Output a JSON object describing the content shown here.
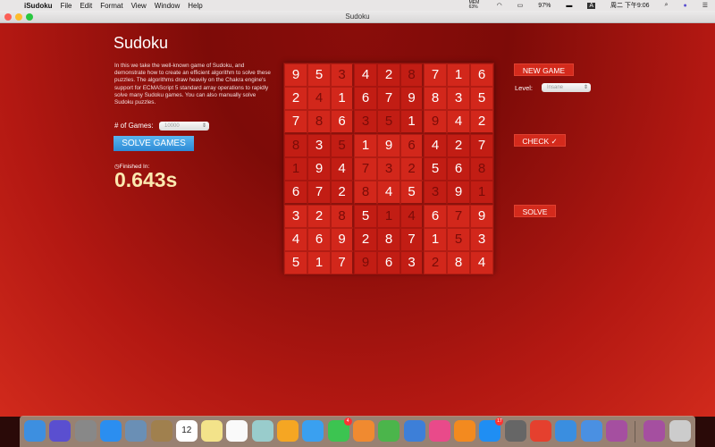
{
  "menubar": {
    "apple": "",
    "app": "iSudoku",
    "items": [
      "File",
      "Edit",
      "Format",
      "View",
      "Window",
      "Help"
    ],
    "mem": "MEM 63%",
    "battery": "97%",
    "input": "A",
    "clock": "周二 下午9:06"
  },
  "window": {
    "title": "Sudoku"
  },
  "page": {
    "title": "Sudoku",
    "description": "In this we take the well-known game of Sudoku, and demonstrate how to create an efficient algorithm to solve these puzzles. The algorithms draw heavily on the Chakra engine's support for ECMAScript 5 standard array operations to rapidly solve many Sudoku games. You can also manually solve Sudoku puzzles.",
    "games_label": "# of Games:",
    "games_value": "10000",
    "solve_games": "SOLVE GAMES",
    "finished_label": "Finished In:",
    "finished_time": "0.643s",
    "new_game": "NEW GAME",
    "level_label": "Level:",
    "level_value": "Insane",
    "check": "CHECK ✓",
    "solve": "SOLVE"
  },
  "grid": [
    "953428716",
    "241679835",
    "786351942",
    "835196427",
    "194732568",
    "672845391",
    "328514679",
    "469287153",
    "517963284"
  ],
  "given": [
    "001001000",
    "010000000",
    "010110100",
    "101001000",
    "100111001",
    "000100101",
    "001011010",
    "000000010",
    "000100100"
  ],
  "dock": [
    {
      "name": "finder",
      "c": "#3d8fe0"
    },
    {
      "name": "siri",
      "c": "#5a4fd0"
    },
    {
      "name": "launchpad",
      "c": "#888"
    },
    {
      "name": "safari",
      "c": "#2b8ef0"
    },
    {
      "name": "preview-photo",
      "c": "#6a8fb5"
    },
    {
      "name": "contacts",
      "c": "#a0804e"
    },
    {
      "name": "calendar",
      "c": "#fff",
      "t": "12"
    },
    {
      "name": "notes",
      "c": "#f3e38a"
    },
    {
      "name": "reminders",
      "c": "#fafafa"
    },
    {
      "name": "preview",
      "c": "#9cc"
    },
    {
      "name": "photos",
      "c": "#f5a623"
    },
    {
      "name": "messages",
      "c": "#3aa0f0"
    },
    {
      "name": "facetime",
      "c": "#3cc451",
      "badge": "4"
    },
    {
      "name": "pages",
      "c": "#f08a30"
    },
    {
      "name": "numbers",
      "c": "#4bb54b"
    },
    {
      "name": "keynote",
      "c": "#3d7fd8"
    },
    {
      "name": "itunes",
      "c": "#e94a8a"
    },
    {
      "name": "ibooks",
      "c": "#f38a1f"
    },
    {
      "name": "app-store",
      "c": "#1f8ef3",
      "badge": "17"
    },
    {
      "name": "system-preferences",
      "c": "#666"
    },
    {
      "name": "chrome",
      "c": "#e5402e"
    },
    {
      "name": "rocket-app",
      "c": "#3a8ee0"
    },
    {
      "name": "xcode",
      "c": "#4a90e2"
    },
    {
      "name": "game-app",
      "c": "#a54fa0"
    },
    {
      "name": "game-app-2",
      "c": "#a54fa0"
    },
    {
      "name": "trash",
      "c": "#ccc"
    }
  ]
}
